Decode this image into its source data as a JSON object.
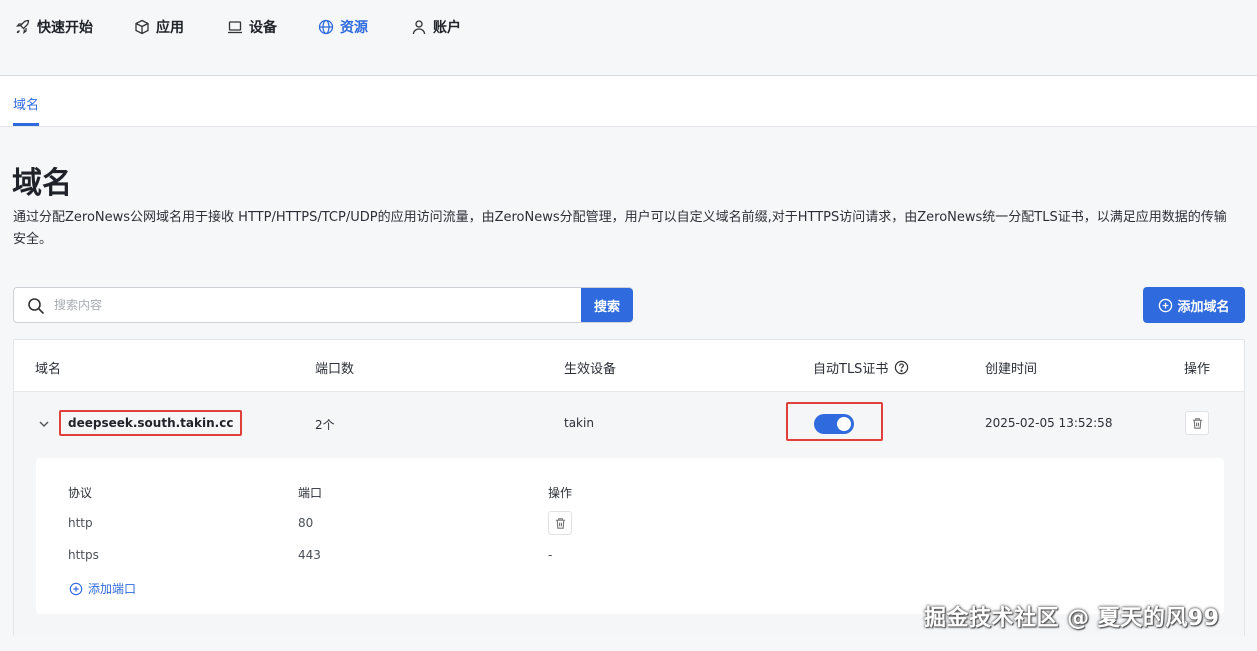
{
  "nav": {
    "items": [
      {
        "label": "快速开始",
        "icon": "rocket-icon"
      },
      {
        "label": "应用",
        "icon": "cube-icon"
      },
      {
        "label": "设备",
        "icon": "laptop-icon"
      },
      {
        "label": "资源",
        "icon": "globe-icon",
        "active": true
      },
      {
        "label": "账户",
        "icon": "user-icon"
      }
    ]
  },
  "subtabs": {
    "domain": "域名"
  },
  "page": {
    "title": "域名",
    "description": "通过分配ZeroNews公网域名用于接收 HTTP/HTTPS/TCP/UDP的应用访问流量，由ZeroNews分配管理，用户可以自定义域名前缀,对于HTTPS访问请求，由ZeroNews统一分配TLS证书，以满足应用数据的传输安全。"
  },
  "search": {
    "placeholder": "搜索内容",
    "button": "搜索"
  },
  "add_domain": {
    "label": "添加域名"
  },
  "table": {
    "headers": [
      "域名",
      "端口数",
      "生效设备",
      "自动TLS证书",
      "创建时间",
      "操作"
    ],
    "rows": [
      {
        "domain": "deepseek.south.takin.cc",
        "ports": "2个",
        "device": "takin",
        "auto_tls": true,
        "created": "2025-02-05 13:52:58"
      }
    ]
  },
  "ports": {
    "headers": [
      "协议",
      "端口",
      "操作"
    ],
    "rows": [
      {
        "protocol": "http",
        "port": "80",
        "action": "delete"
      },
      {
        "protocol": "https",
        "port": "443",
        "action": "-"
      }
    ],
    "add_label": "添加端口"
  },
  "watermark": "掘金技术社区 @ 夏天的风99",
  "colors": {
    "accent": "#2f6bde",
    "highlight": "#e0403a"
  }
}
